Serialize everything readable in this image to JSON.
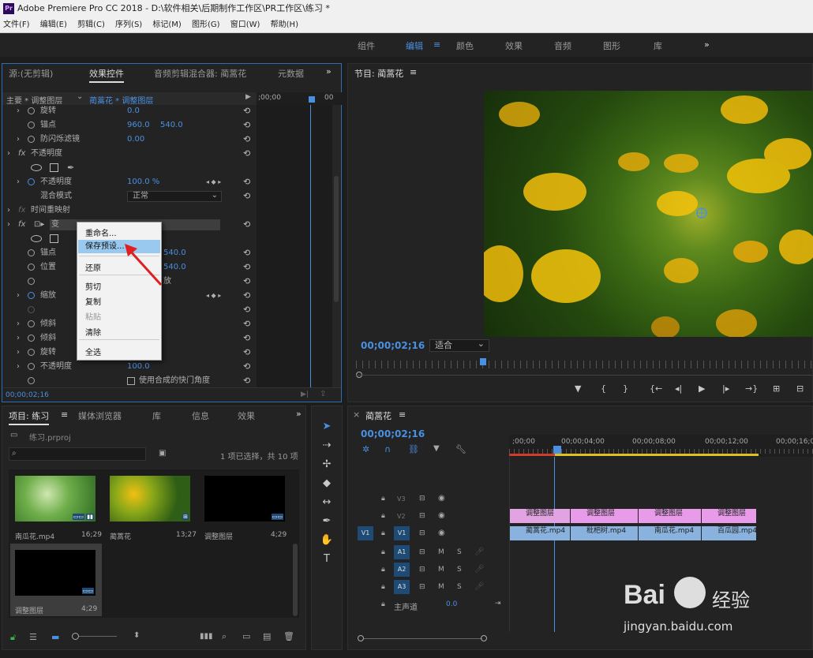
{
  "window": {
    "title": "Adobe Premiere Pro CC 2018 - D:\\软件相关\\后期制作工作区\\PR工作区\\练习 *",
    "logo": "Pr"
  },
  "menu": [
    "文件(F)",
    "编辑(E)",
    "剪辑(C)",
    "序列(S)",
    "标记(M)",
    "图形(G)",
    "窗口(W)",
    "帮助(H)"
  ],
  "workspaces": {
    "items": [
      "组件",
      "编辑",
      "颜色",
      "效果",
      "音频",
      "图形",
      "库"
    ],
    "active": "编辑",
    "more": "»"
  },
  "effect_controls": {
    "tabs": [
      "源:(无剪辑)",
      "效果控件",
      "音频剪辑混合器: 蔺蒿花",
      "元数据"
    ],
    "master": "主要 * 调整图层",
    "clip": "蔺蒿花 * 调整图层",
    "ruler_time": ";00;00",
    "ruler_end": "00",
    "rows": [
      {
        "label": "旋转",
        "v1": "0.0",
        "v2": ""
      },
      {
        "label": "锚点",
        "v1": "960.0",
        "v2": "540.0"
      },
      {
        "label": "防闪烁滤镜",
        "v1": "0.00",
        "v2": ""
      },
      {
        "label": "不透明度",
        "v1": "",
        "v2": ""
      },
      {
        "label": "",
        "v1": "",
        "v2": ""
      },
      {
        "label": "不透明度",
        "v1": "100.0 %",
        "v2": ""
      },
      {
        "label": "混合模式",
        "v1": "正常",
        "v2": ""
      },
      {
        "label": "时间重映射",
        "v1": "",
        "v2": ""
      },
      {
        "label": "变",
        "v1": "",
        "v2": ""
      },
      {
        "label": "",
        "v1": "",
        "v2": ""
      },
      {
        "label": "锚点",
        "v1": "",
        "v2": "540.0"
      },
      {
        "label": "位置",
        "v1": "",
        "v2": "540.0"
      },
      {
        "label": "",
        "v1": "",
        "v2": "放"
      },
      {
        "label": "缩放",
        "v1": "",
        "v2": ""
      },
      {
        "label": "",
        "v1": "",
        "v2": ""
      },
      {
        "label": "倾斜",
        "v1": "",
        "v2": ""
      },
      {
        "label": "倾斜",
        "v1": "",
        "v2": ""
      },
      {
        "label": "旋转",
        "v1": "",
        "v2": ""
      },
      {
        "label": "不透明度",
        "v1": "100.0",
        "v2": ""
      },
      {
        "label": "",
        "v1": "使用合成的快门角度",
        "v2": ""
      }
    ],
    "timecode": "00;00;02;16"
  },
  "context_menu": {
    "items": [
      "重命名...",
      "保存预设...",
      "还原",
      "剪切",
      "复制",
      "粘贴",
      "清除",
      "全选"
    ],
    "highlighted": "保存预设..."
  },
  "program": {
    "title": "节目: 蔺蒿花",
    "timecode": "00;00;02;16",
    "fit": "适合",
    "fit_arrow": "⌄"
  },
  "project": {
    "tabs": [
      "项目: 练习",
      "媒体浏览器",
      "库",
      "信息",
      "效果"
    ],
    "file": "练习.prproj",
    "status": "1 项已选择，共 10 项",
    "search_placeholder": "",
    "items": [
      {
        "name": "南瓜花.mp4",
        "dur": "16;29"
      },
      {
        "name": "蔺蒿花",
        "dur": "13;27"
      },
      {
        "name": "调整图层",
        "dur": "4;29"
      },
      {
        "name": "调整图层",
        "dur": "4;29"
      }
    ]
  },
  "timeline": {
    "title": "蔺蒿花",
    "timecode": "00;00;02;16",
    "ruler": [
      ";00;00",
      "00;00;04;00",
      "00;00;08;00",
      "00;00;12;00",
      "00;00;16;00"
    ],
    "tracks": [
      "V3",
      "V2",
      "V1",
      "A1",
      "A2",
      "A3"
    ],
    "master": "主声道",
    "master_val": "0.0",
    "v2_clips": [
      "调整图层",
      "调整图层",
      "调整图层",
      "调整图层"
    ],
    "v1_clips": [
      "蔺蒿花.mp4",
      "枇杷树.mp4",
      "南瓜花.mp4",
      "百瓜园.mp4"
    ]
  },
  "watermark": {
    "brand": "Bai",
    "suffix": "经验",
    "url": "jingyan.baidu.com"
  }
}
